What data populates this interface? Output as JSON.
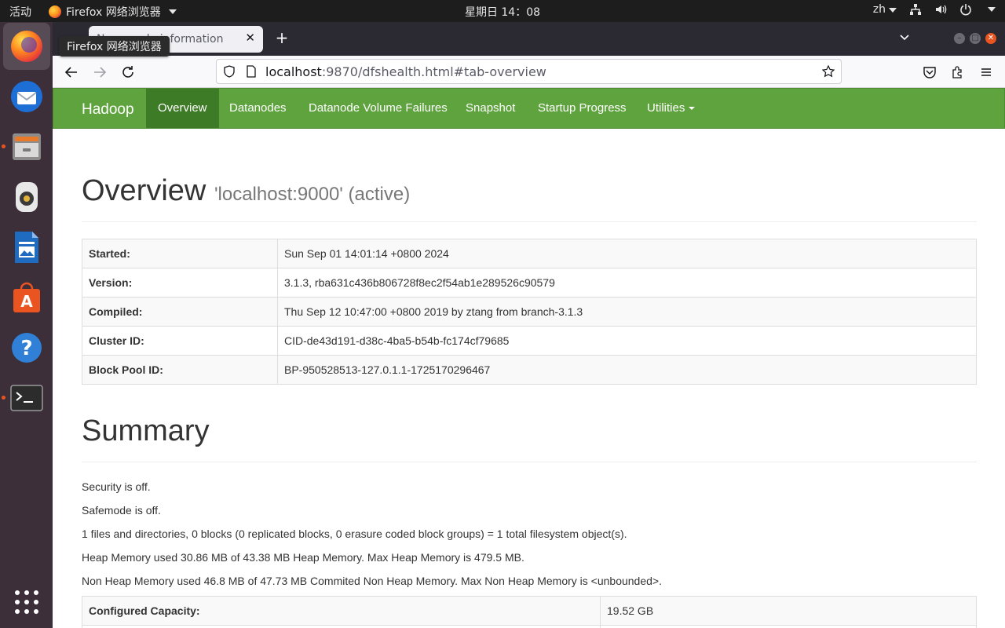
{
  "topbar": {
    "activities": "活动",
    "app_name": "Firefox 网络浏览器",
    "clock": "星期日 14：08",
    "lang": "zh"
  },
  "dock": {
    "apps": [
      "firefox-icon",
      "thunderbird-icon",
      "files-icon",
      "rhythmbox-icon",
      "libreoffice-writer-icon",
      "ubuntu-software-icon",
      "help-icon",
      "terminal-icon"
    ],
    "show_apps": "show-apps-icon"
  },
  "browser": {
    "tooltip": "Firefox 网络浏览器",
    "tab_title": "Namenode information",
    "url_host": "localhost",
    "url_rest": ":9870/dfshealth.html#tab-overview"
  },
  "hadoop_nav": {
    "brand": "Hadoop",
    "items": [
      "Overview",
      "Datanodes",
      "Datanode Volume Failures",
      "Snapshot",
      "Startup Progress",
      "Utilities"
    ]
  },
  "overview": {
    "title": "Overview",
    "subtitle": "'localhost:9000' (active)",
    "rows": [
      {
        "key": "Started:",
        "value": "Sun Sep 01 14:01:14 +0800 2024"
      },
      {
        "key": "Version:",
        "value": "3.1.3, rba631c436b806728f8ec2f54ab1e289526c90579"
      },
      {
        "key": "Compiled:",
        "value": "Thu Sep 12 10:47:00 +0800 2019 by ztang from branch-3.1.3"
      },
      {
        "key": "Cluster ID:",
        "value": "CID-de43d191-d38c-4ba5-b54b-fc174cf79685"
      },
      {
        "key": "Block Pool ID:",
        "value": "BP-950528513-127.0.1.1-1725170296467"
      }
    ]
  },
  "summary": {
    "title": "Summary",
    "lines": [
      "Security is off.",
      "Safemode is off.",
      "1 files and directories, 0 blocks (0 replicated blocks, 0 erasure coded block groups) = 1 total filesystem object(s).",
      "Heap Memory used 30.86 MB of 43.38 MB Heap Memory. Max Heap Memory is 479.5 MB.",
      "Non Heap Memory used 46.8 MB of 47.73 MB Commited Non Heap Memory. Max Non Heap Memory is <unbounded>."
    ],
    "capacity_key": "Configured Capacity:",
    "capacity_value": "19.52 GB"
  },
  "colors": {
    "hadoop_green": "#5fa33e",
    "hadoop_active": "#3e7b27",
    "ubuntu_orange": "#e95420"
  }
}
